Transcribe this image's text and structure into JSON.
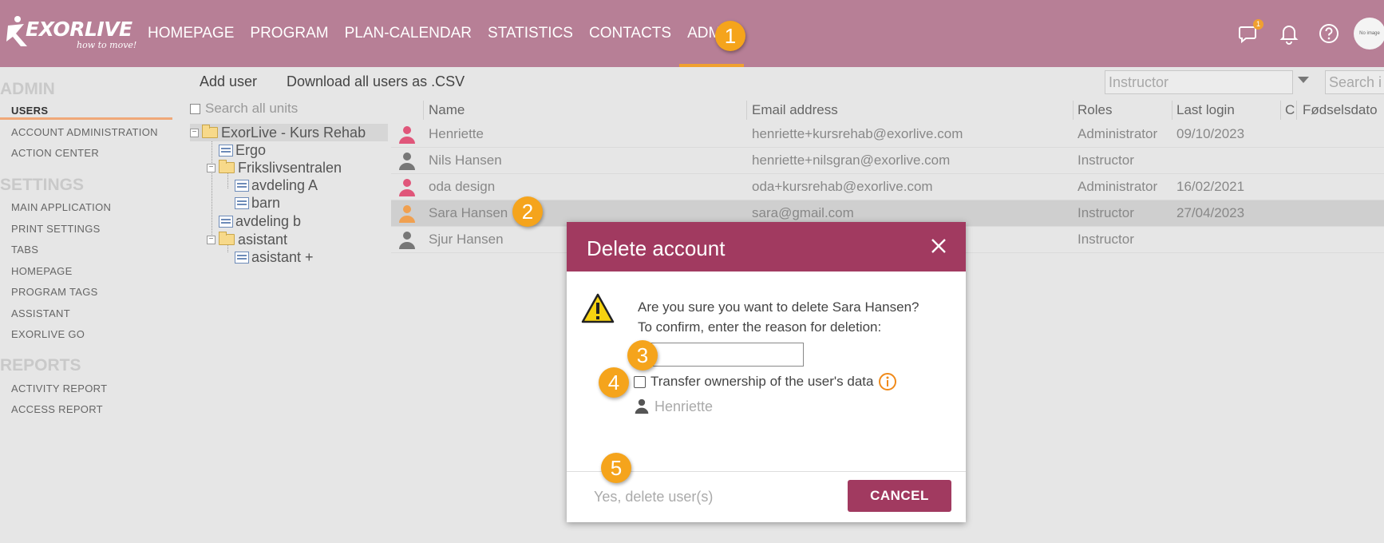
{
  "app": {
    "brand": "EXORLIVE",
    "tagline": "how to move!",
    "nav": [
      "HOMEPAGE",
      "PROGRAM",
      "PLAN-CALENDAR",
      "STATISTICS",
      "CONTACTS",
      "ADMIN"
    ],
    "active_nav": "ADMIN",
    "chat_count": "1",
    "avatar_text": "No image"
  },
  "badges": {
    "b1": "1",
    "b2": "2",
    "b3": "3",
    "b4": "4",
    "b5": "5"
  },
  "sidebar": {
    "admin_title": "ADMIN",
    "admin_items": [
      "USERS",
      "ACCOUNT ADMINISTRATION",
      "ACTION CENTER"
    ],
    "settings_title": "SETTINGS",
    "settings_items": [
      "MAIN APPLICATION",
      "PRINT SETTINGS",
      "TABS",
      "HOMEPAGE",
      "PROGRAM TAGS",
      "ASSISTANT",
      "EXORLIVE GO"
    ],
    "reports_title": "REPORTS",
    "reports_items": [
      "ACTIVITY REPORT",
      "ACCESS REPORT"
    ]
  },
  "toolbar": {
    "add_user": "Add user",
    "download_csv": "Download all users as .CSV",
    "role_select": "Instructor",
    "search_placeholder": "Search i"
  },
  "tree": {
    "search_label": "Search all units",
    "nodes": [
      "ExorLive - Kurs Rehab",
      "Ergo",
      "Frikslivsentralen",
      "avdeling A",
      "barn",
      "avdeling b",
      "asistant",
      "asistant +"
    ]
  },
  "table": {
    "headers": {
      "name": "Name",
      "email": "Email address",
      "roles": "Roles",
      "last_login": "Last login",
      "c": "C",
      "birth": "Fødselsdato"
    },
    "rows": [
      {
        "name": "Henriette",
        "email": "henriette+kursrehab@exorlive.com",
        "role": "Administrator",
        "last_login": "09/10/2023",
        "icon_color": "#e0567a"
      },
      {
        "name": "Nils Hansen",
        "email": "henriette+nilsgran@exorlive.com",
        "role": "Instructor",
        "last_login": "",
        "icon_color": "#777777"
      },
      {
        "name": "oda design",
        "email": "oda+kursrehab@exorlive.com",
        "role": "Administrator",
        "last_login": "16/02/2021",
        "icon_color": "#e0567a"
      },
      {
        "name": "Sara Hansen",
        "email": "sara@gmail.com",
        "role": "Instructor",
        "last_login": "27/04/2023",
        "icon_color": "#f0a050"
      },
      {
        "name": "Sjur Hansen",
        "email": "",
        "role": "Instructor",
        "last_login": "",
        "icon_color": "#777777"
      }
    ]
  },
  "dialog": {
    "title": "Delete account",
    "question": "Are you sure you want to delete Sara Hansen?",
    "confirm_text": "To confirm, enter the reason for deletion:",
    "reason_value": "",
    "transfer_label": "Transfer ownership of the user's data",
    "owner_name": "Henriette",
    "yes_button": "Yes, delete user(s)",
    "cancel_button": "CANCEL"
  }
}
